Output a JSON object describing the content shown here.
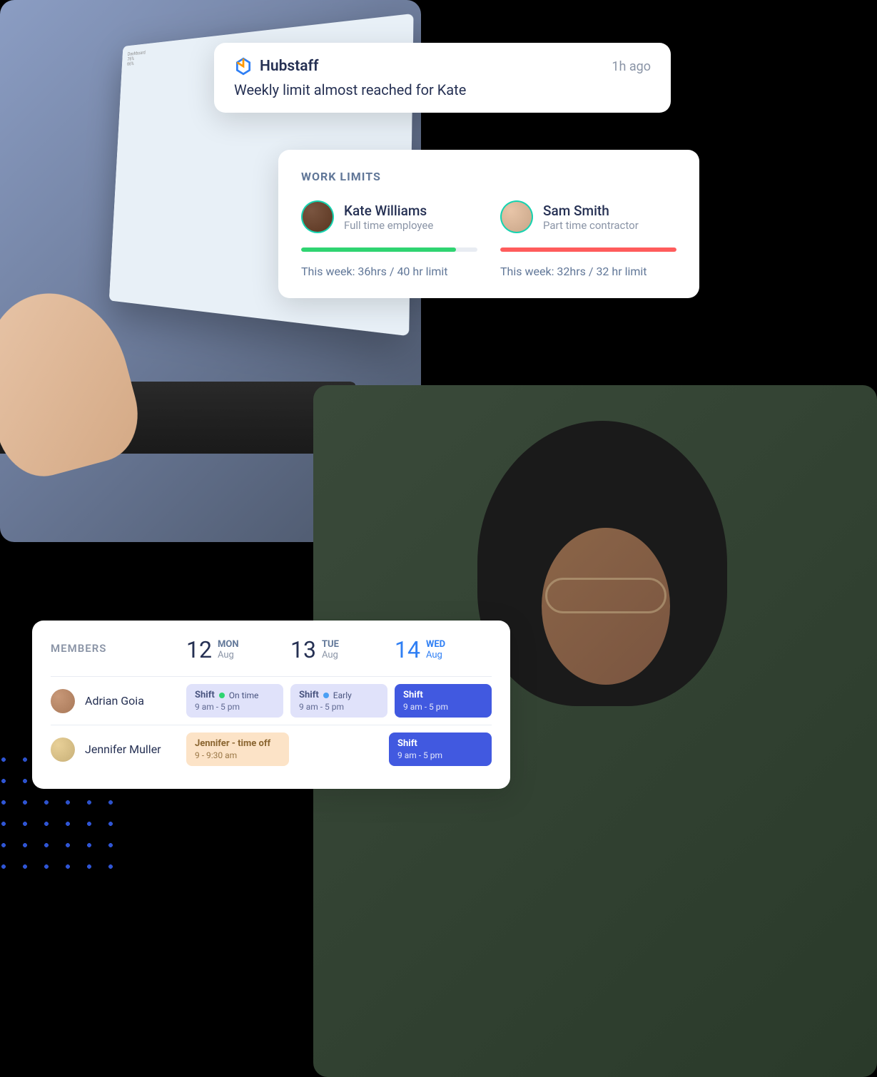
{
  "notification": {
    "brand": "Hubstaff",
    "time": "1h ago",
    "message": "Weekly limit almost reached for Kate"
  },
  "work_limits": {
    "title": "WORK LIMITS",
    "members": [
      {
        "name": "Kate Williams",
        "role": "Full time employee",
        "summary": "This week: 36hrs / 40 hr limit",
        "progress_pct": 88,
        "color": "green"
      },
      {
        "name": "Sam Smith",
        "role": "Part time contractor",
        "summary": "This week: 32hrs / 32 hr limit",
        "progress_pct": 100,
        "color": "red"
      }
    ]
  },
  "schedule": {
    "title": "MEMBERS",
    "days": [
      {
        "num": "12",
        "name": "MON",
        "month": "Aug",
        "active": false
      },
      {
        "num": "13",
        "name": "TUE",
        "month": "Aug",
        "active": false
      },
      {
        "num": "14",
        "name": "WED",
        "month": "Aug",
        "active": true
      }
    ],
    "members": [
      {
        "name": "Adrian Goia",
        "shifts": [
          {
            "label": "Shift",
            "status": "On time",
            "dot": "green",
            "time": "9 am - 5 pm",
            "style": "purple"
          },
          {
            "label": "Shift",
            "status": "Early",
            "dot": "blue",
            "time": "9 am - 5 pm",
            "style": "purple"
          },
          {
            "label": "Shift",
            "status": "",
            "dot": "",
            "time": "9 am - 5 pm",
            "style": "blue"
          }
        ]
      },
      {
        "name": "Jennifer Muller",
        "shifts": [
          {
            "label": "Jennifer - time off",
            "status": "",
            "dot": "",
            "time": "9 - 9:30 am",
            "style": "orange"
          },
          {
            "label": "",
            "status": "",
            "dot": "",
            "time": "",
            "style": "empty"
          },
          {
            "label": "Shift",
            "status": "",
            "dot": "",
            "time": "9 am - 5 pm",
            "style": "blue"
          }
        ]
      }
    ]
  }
}
